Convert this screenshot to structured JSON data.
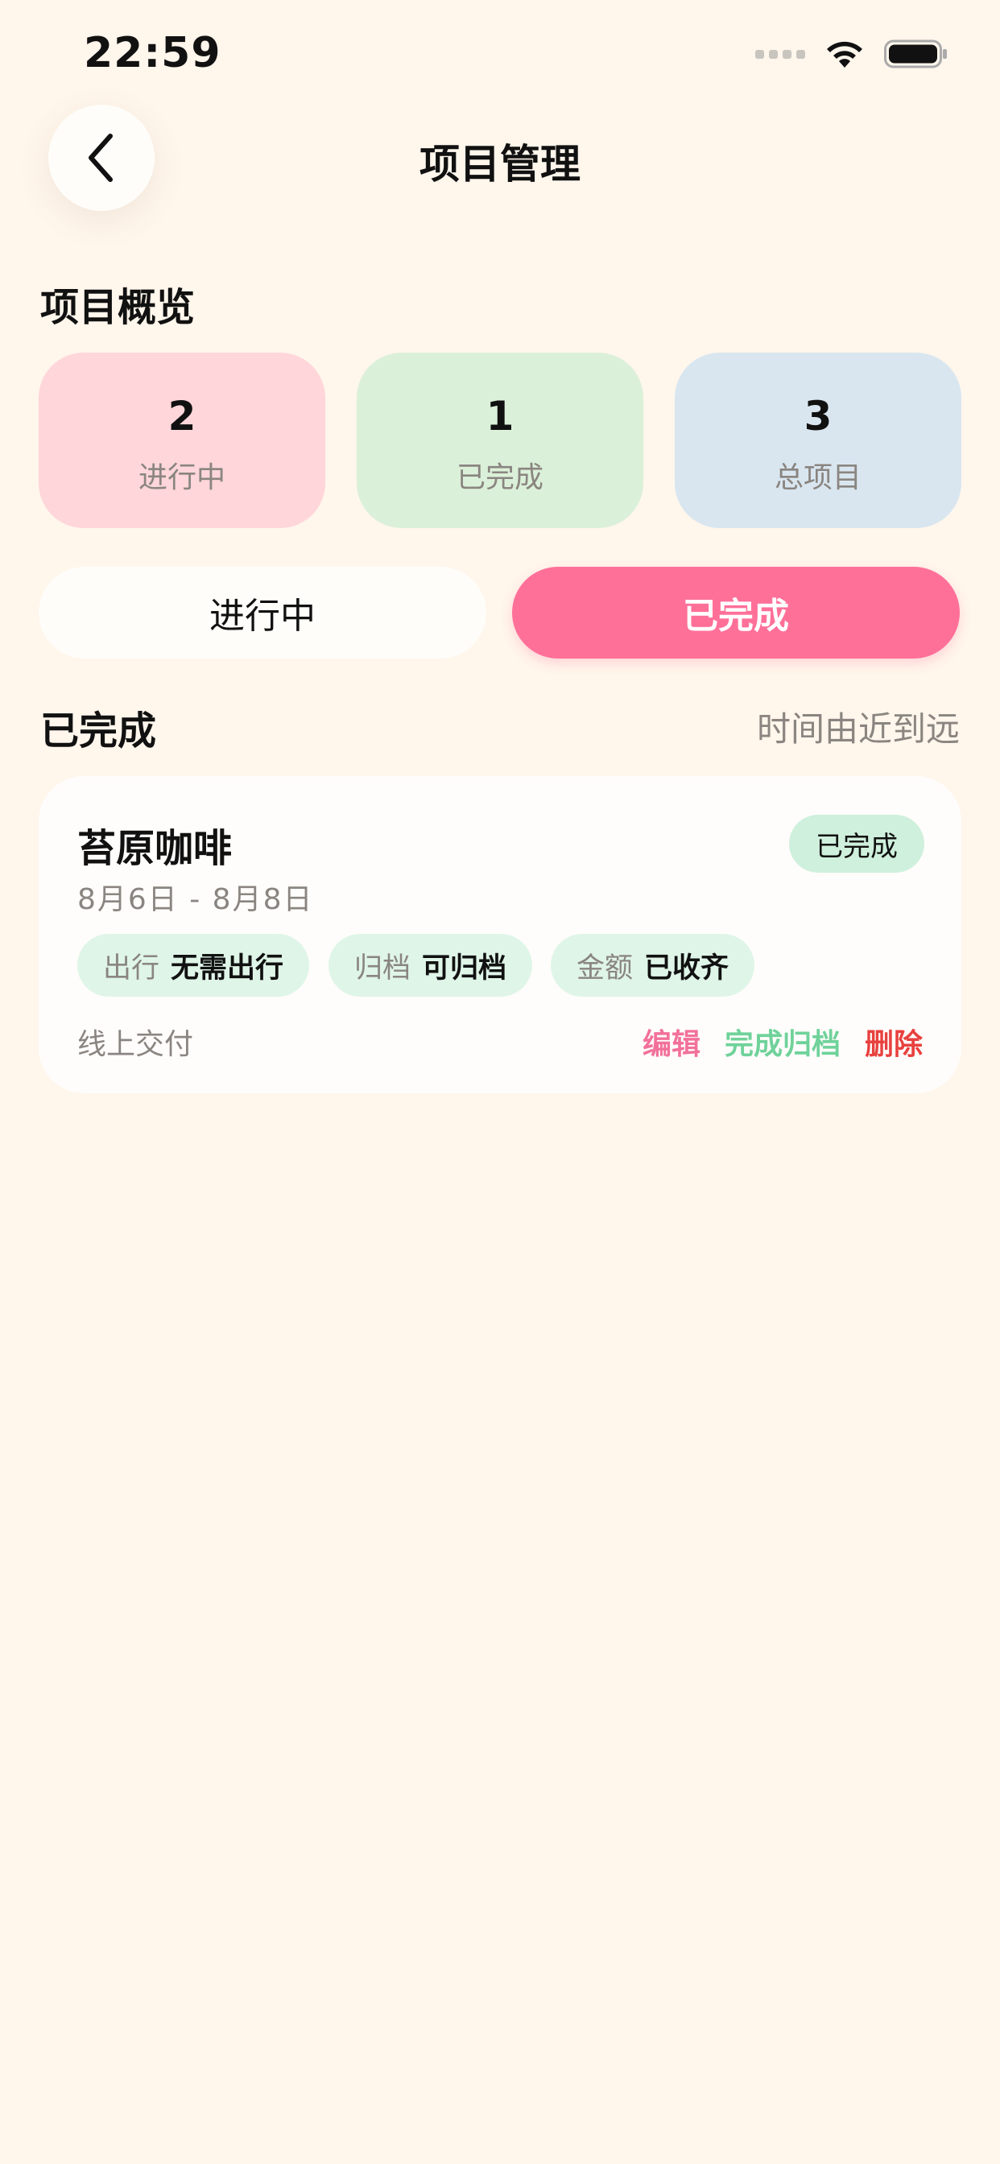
{
  "status_bar": {
    "time": "22:59",
    "icons": [
      "signal-dots-icon",
      "wifi-icon",
      "battery-icon"
    ]
  },
  "header": {
    "back_icon": "chevron-left-icon",
    "title": "项目管理"
  },
  "overview": {
    "title": "项目概览",
    "cards": [
      {
        "value": "2",
        "label": "进行中",
        "color": "#FFD6DA"
      },
      {
        "value": "1",
        "label": "已完成",
        "color": "#DBF0D8"
      },
      {
        "value": "3",
        "label": "总项目",
        "color": "#D9E6F0"
      }
    ]
  },
  "tabs": [
    {
      "label": "进行中",
      "active": false
    },
    {
      "label": "已完成",
      "active": true
    }
  ],
  "list": {
    "section_title": "已完成",
    "sort_label": "时间由近到远",
    "items": [
      {
        "name": "苔原咖啡",
        "date_range": "8月6日 - 8月8日",
        "status": "已完成",
        "tags": [
          {
            "key": "出行",
            "value": "无需出行"
          },
          {
            "key": "归档",
            "value": "可归档"
          },
          {
            "key": "金额",
            "value": "已收齐"
          }
        ],
        "delivery": "线上交付",
        "actions": [
          {
            "label": "编辑",
            "color": "#F2719B"
          },
          {
            "label": "完成归档",
            "color": "#6FD29A"
          },
          {
            "label": "删除",
            "color": "#E8413E"
          }
        ]
      }
    ]
  },
  "colors": {
    "background": "#FFF6EC",
    "accent": "#FF7099"
  }
}
